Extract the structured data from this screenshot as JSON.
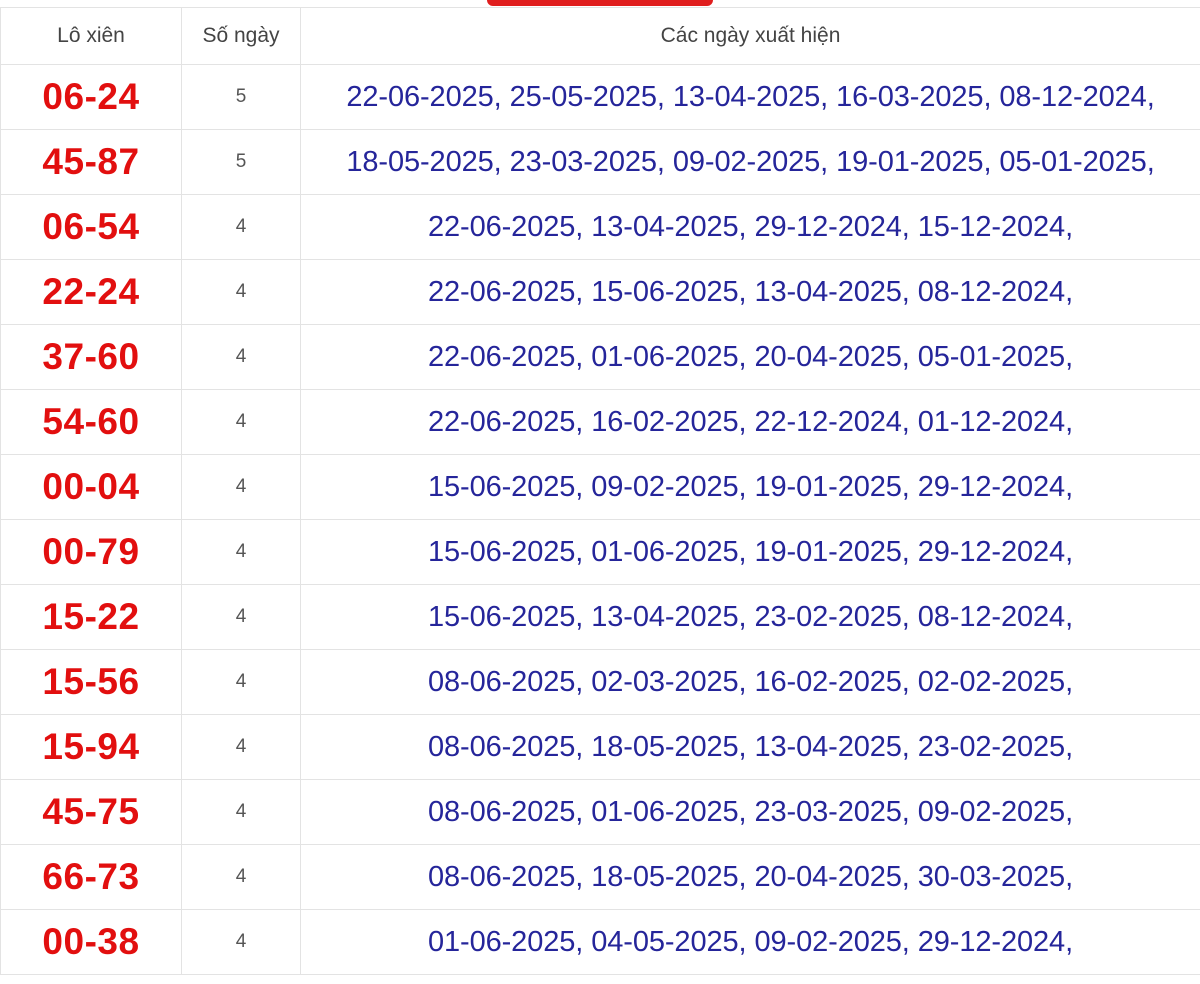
{
  "header": {
    "col_pair": "Lô xiên",
    "col_count": "Số ngày",
    "col_dates": "Các ngày xuất hiện"
  },
  "accent_color": "#e20f0f",
  "date_color": "#25259a",
  "rows": [
    {
      "pair": "06-24",
      "count": "5",
      "dates": "22-06-2025, 25-05-2025, 13-04-2025, 16-03-2025, 08-12-2024,"
    },
    {
      "pair": "45-87",
      "count": "5",
      "dates": "18-05-2025, 23-03-2025, 09-02-2025, 19-01-2025, 05-01-2025,"
    },
    {
      "pair": "06-54",
      "count": "4",
      "dates": "22-06-2025, 13-04-2025, 29-12-2024, 15-12-2024,"
    },
    {
      "pair": "22-24",
      "count": "4",
      "dates": "22-06-2025, 15-06-2025, 13-04-2025, 08-12-2024,"
    },
    {
      "pair": "37-60",
      "count": "4",
      "dates": "22-06-2025, 01-06-2025, 20-04-2025, 05-01-2025,"
    },
    {
      "pair": "54-60",
      "count": "4",
      "dates": "22-06-2025, 16-02-2025, 22-12-2024, 01-12-2024,"
    },
    {
      "pair": "00-04",
      "count": "4",
      "dates": "15-06-2025, 09-02-2025, 19-01-2025, 29-12-2024,"
    },
    {
      "pair": "00-79",
      "count": "4",
      "dates": "15-06-2025, 01-06-2025, 19-01-2025, 29-12-2024,"
    },
    {
      "pair": "15-22",
      "count": "4",
      "dates": "15-06-2025, 13-04-2025, 23-02-2025, 08-12-2024,"
    },
    {
      "pair": "15-56",
      "count": "4",
      "dates": "08-06-2025, 02-03-2025, 16-02-2025, 02-02-2025,"
    },
    {
      "pair": "15-94",
      "count": "4",
      "dates": "08-06-2025, 18-05-2025, 13-04-2025, 23-02-2025,"
    },
    {
      "pair": "45-75",
      "count": "4",
      "dates": "08-06-2025, 01-06-2025, 23-03-2025, 09-02-2025,"
    },
    {
      "pair": "66-73",
      "count": "4",
      "dates": "08-06-2025, 18-05-2025, 20-04-2025, 30-03-2025,"
    },
    {
      "pair": "00-38",
      "count": "4",
      "dates": "01-06-2025, 04-05-2025, 09-02-2025, 29-12-2024,"
    }
  ]
}
